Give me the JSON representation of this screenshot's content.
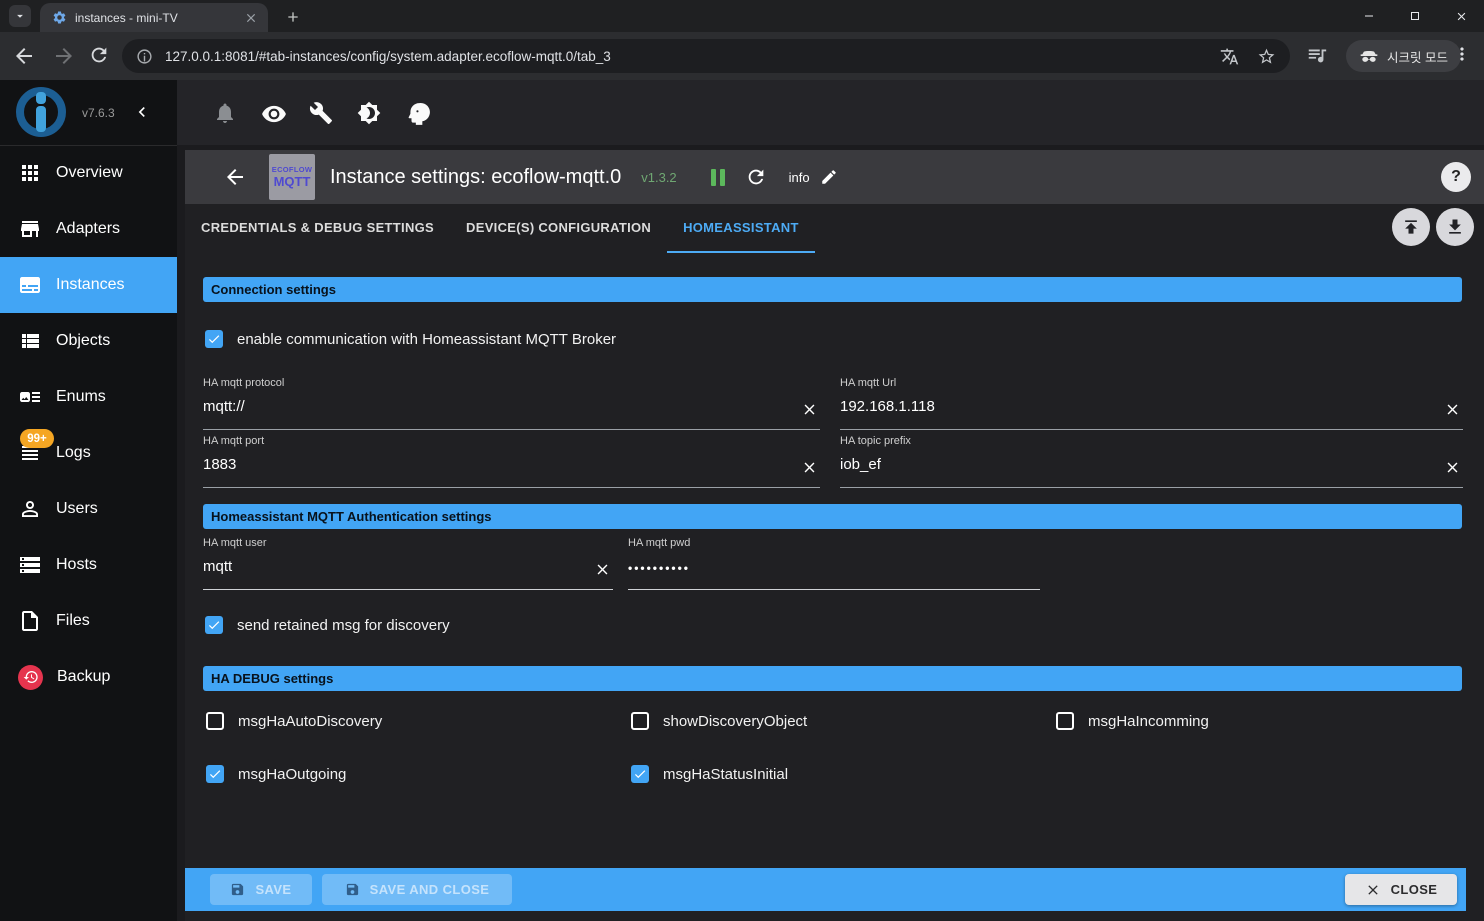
{
  "window": {
    "tab_title": "instances - mini-TV"
  },
  "browser": {
    "url": "127.0.0.1:8081/#tab-instances/config/system.adapter.ecoflow-mqtt.0/tab_3",
    "incognito_label": "시크릿 모드"
  },
  "sidebar": {
    "version": "v7.6.3",
    "items": [
      {
        "label": "Overview"
      },
      {
        "label": "Adapters"
      },
      {
        "label": "Instances",
        "active": true
      },
      {
        "label": "Objects"
      },
      {
        "label": "Enums"
      },
      {
        "label": "Logs",
        "badge": "99+"
      },
      {
        "label": "Users"
      },
      {
        "label": "Hosts"
      },
      {
        "label": "Files"
      },
      {
        "label": "Backup"
      }
    ]
  },
  "dialog": {
    "adapter_badge": {
      "line1": "ECOFLOW",
      "line2": "MQTT"
    },
    "title": "Instance settings: ecoflow-mqtt.0",
    "version": "v1.3.2",
    "info_label": "info",
    "help_label": "?",
    "tabs": [
      {
        "label": "CREDENTIALS & DEBUG SETTINGS",
        "active": false
      },
      {
        "label": "DEVICE(S) CONFIGURATION",
        "active": false
      },
      {
        "label": "HOMEASSISTANT",
        "active": true
      }
    ],
    "sections": {
      "connection": {
        "title": "Connection settings",
        "enable_checkbox": {
          "label": "enable communication with Homeassistant MQTT Broker",
          "checked": true
        },
        "fields": [
          {
            "label": "HA mqtt protocol",
            "value": "mqtt://",
            "clearable": true
          },
          {
            "label": "HA mqtt Url",
            "value": "192.168.1.118",
            "clearable": true
          },
          {
            "label": "HA mqtt port",
            "value": "1883",
            "clearable": true
          },
          {
            "label": "HA topic prefix",
            "value": "iob_ef",
            "clearable": true
          }
        ]
      },
      "auth": {
        "title": "Homeassistant MQTT Authentication settings",
        "fields": [
          {
            "label": "HA mqtt user",
            "value": "mqtt",
            "clearable": true
          },
          {
            "label": "HA mqtt pwd",
            "value": "••••••••••",
            "masked": true,
            "clearable": false
          }
        ],
        "retained_checkbox": {
          "label": "send retained msg for discovery",
          "checked": true
        }
      },
      "debug": {
        "title": "HA DEBUG settings",
        "checkboxes": [
          {
            "label": "msgHaAutoDiscovery",
            "checked": false
          },
          {
            "label": "showDiscoveryObject",
            "checked": false
          },
          {
            "label": "msgHaIncomming",
            "checked": false
          },
          {
            "label": "msgHaOutgoing",
            "checked": true
          },
          {
            "label": "msgHaStatusInitial",
            "checked": true
          }
        ]
      }
    },
    "footer": {
      "save": "SAVE",
      "save_and_close": "SAVE AND CLOSE",
      "close": "CLOSE"
    }
  },
  "colors": {
    "accent": "#42a5f5",
    "version_green": "#6fa772",
    "badge_orange": "#f5a623",
    "backup_red": "#e5344e"
  }
}
